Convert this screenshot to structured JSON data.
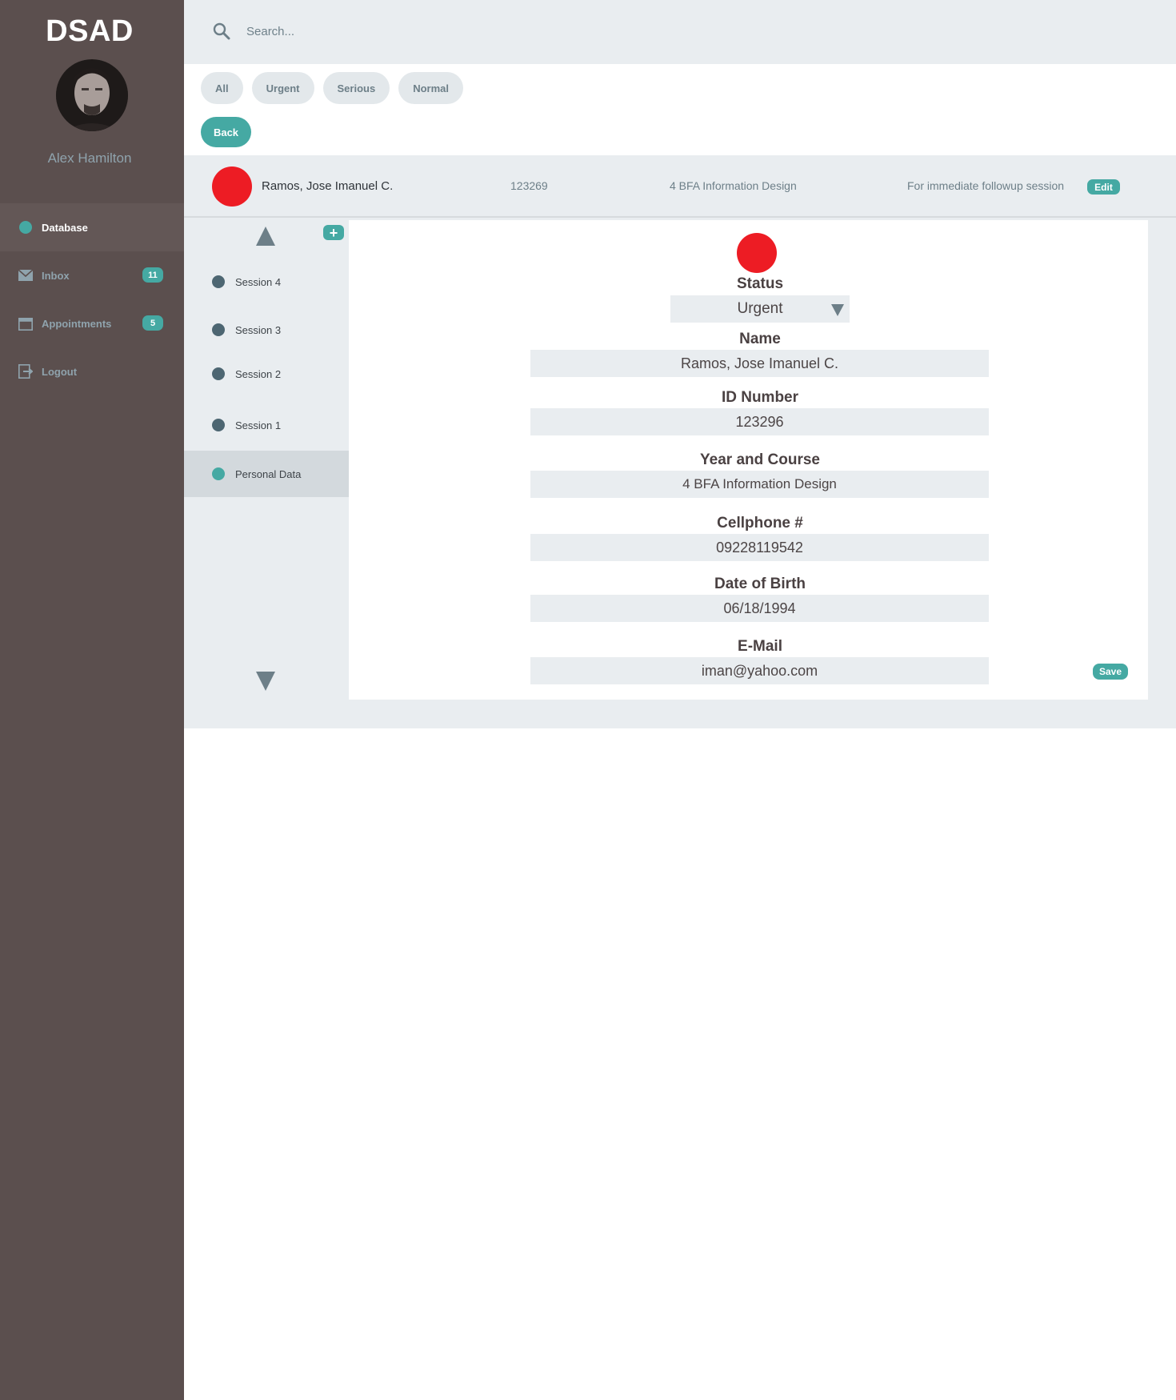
{
  "app": {
    "brand": "DSAD"
  },
  "user": {
    "name": "Alex Hamilton"
  },
  "sidebar": {
    "items": [
      {
        "label": "Database",
        "icon": "dot-icon",
        "active": true
      },
      {
        "label": "Inbox",
        "icon": "mail-icon",
        "badge": "11"
      },
      {
        "label": "Appointments",
        "icon": "calendar-icon",
        "badge": "5"
      },
      {
        "label": "Logout",
        "icon": "logout-icon"
      }
    ]
  },
  "search": {
    "placeholder": "Search..."
  },
  "filters": [
    "All",
    "Urgent",
    "Serious",
    "Normal"
  ],
  "back_label": "Back",
  "patient": {
    "name": "Ramos, Jose Imanuel C.",
    "id": "123269",
    "course": "4 BFA Information Design",
    "note": "For immediate followup session",
    "edit_label": "Edit",
    "status_color": "#ed1c24"
  },
  "sessions": [
    "Session 4",
    "Session 3",
    "Session 2",
    "Session 1",
    "Personal Data"
  ],
  "form": {
    "status_label": "Status",
    "status_value": "Urgent",
    "name_label": "Name",
    "name_value": "Ramos, Jose Imanuel C.",
    "id_label": "ID Number",
    "id_value": "123296",
    "course_label": "Year and Course",
    "course_value": "4 BFA Information Design",
    "phone_label": "Cellphone #",
    "phone_value": "09228119542",
    "dob_label": "Date of Birth",
    "dob_value": "06/18/1994",
    "email_label": "E-Mail",
    "email_value": "iman@yahoo.com",
    "save_label": "Save"
  },
  "colors": {
    "accent": "#45a9a3",
    "sidebar": "#5b4f4e",
    "urgent": "#ed1c24"
  }
}
